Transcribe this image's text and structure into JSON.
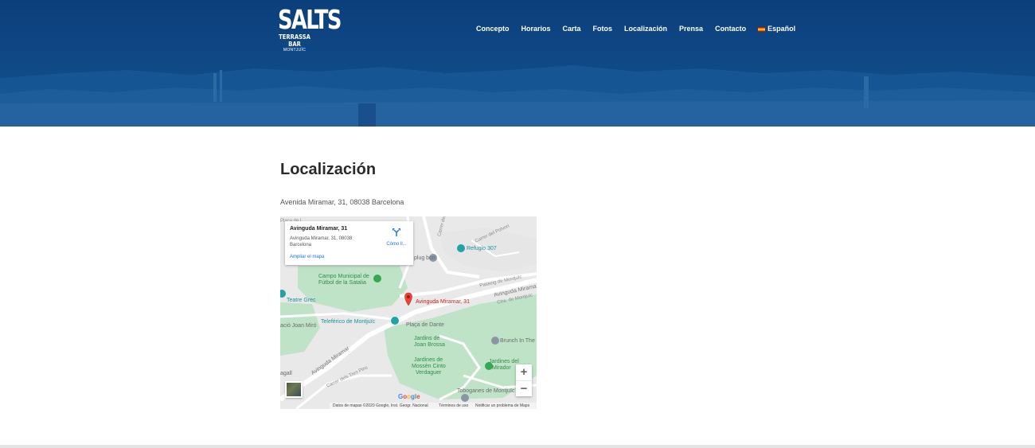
{
  "logo": {
    "main": "SALTS",
    "sub": "TERRASSA BAR",
    "sub2": "MONTJUÏC"
  },
  "nav": {
    "items": [
      "Concepto",
      "Horarios",
      "Carta",
      "Fotos",
      "Localización",
      "Prensa",
      "Contacto"
    ],
    "language": "Español"
  },
  "page": {
    "title": "Localización",
    "address": "Avenida Miramar, 31, 08038 Barcelona"
  },
  "map": {
    "info_window": {
      "title": "Avinguda Miramar, 31",
      "address_line1": "Avinguda Miramar, 31, 08038",
      "address_line2": "Barcelona",
      "link": "Ampliar el mapa",
      "directions": "Cómo ll..."
    },
    "labels": {
      "placa": "Plaça de l",
      "carrer_fonts": "Carrer de la Fonts",
      "carrer_mari": "Carrer del Mari",
      "carrer_polvori": "Carrer del Polvori",
      "plug": "plug bcn",
      "refugio": "Refugio 307",
      "campo1": "Campo Municipal de",
      "campo2": "Fútbol de la Satalia",
      "passeig": "Passeig de Montjuïc",
      "teatre": "Teatre Grec",
      "marker": "Avinguda Miramar, 31",
      "ctra": "Ctra. de Montjuïc",
      "avinguda_miramar_e": "Avinguda Miramar",
      "fundacio": "ació Joan Miró",
      "teleferico": "Teleférico de Montjuïc",
      "placa_dante": "Plaça de Dante",
      "jardins_brossa1": "Jardins de",
      "jardins_brossa2": "Joan Brossa",
      "brunch": "Brunch In The",
      "avinguda_miramar_w": "Avinguda Miramar",
      "jardins_mossen1": "Jardines de",
      "jardins_mossen2": "Mossèn Cinto",
      "jardins_mossen3": "Verdaguer",
      "jardins_mirador1": "Jardines del",
      "jardins_mirador2": "Mirador",
      "segall": "agall",
      "tres_pins": "Carrer dels Tres Pins",
      "toboganes": "Toboganes de Montjuïc",
      "estadi": "Carrer de l'Estadi"
    },
    "zoom_in": "+",
    "zoom_out": "−",
    "google": "Google",
    "footer": {
      "data": "Datos de mapas ©2020 Google, Inst. Geogr. Nacional",
      "terms": "Términos de uso",
      "report": "Notificar un problema de Maps"
    },
    "colors": {
      "park": "#bfe3c6",
      "road": "#ffffff",
      "marker": "#ea4335",
      "link": "#1a73e8"
    }
  },
  "colors": {
    "hero": "#0c4484",
    "title": "#2b2b2b"
  }
}
